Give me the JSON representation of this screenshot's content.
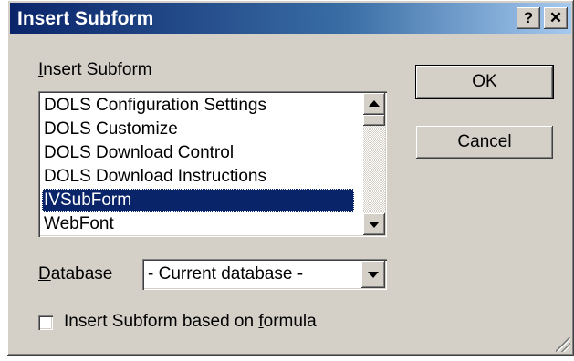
{
  "window": {
    "title": "Insert Subform",
    "help_label": "?",
    "close_label": "✕"
  },
  "subform_list": {
    "label_prefix": "I",
    "label_rest": "nsert Subform",
    "items": [
      "DOLS Configuration Settings",
      "DOLS Customize",
      "DOLS Download Control",
      "DOLS Download Instructions",
      "IVSubForm",
      "WebFont"
    ],
    "selected": "IVSubForm"
  },
  "buttons": {
    "ok_label": "OK",
    "cancel_label": "Cancel"
  },
  "database": {
    "label_prefix": "D",
    "label_rest": "atabase",
    "value": "- Current database -"
  },
  "formula_checkbox": {
    "label_before": "Insert Subform based on ",
    "label_accel": "f",
    "label_after": "ormula",
    "checked": false
  },
  "colors": {
    "dialog_bg": "#d4d0c8",
    "titlebar": "#0a246a",
    "selection": "#0a246a"
  },
  "icons": [
    "help-icon",
    "close-icon",
    "scroll-up-arrow-icon",
    "scroll-down-arrow-icon",
    "dropdown-arrow-icon",
    "resize-grip-icon"
  ]
}
